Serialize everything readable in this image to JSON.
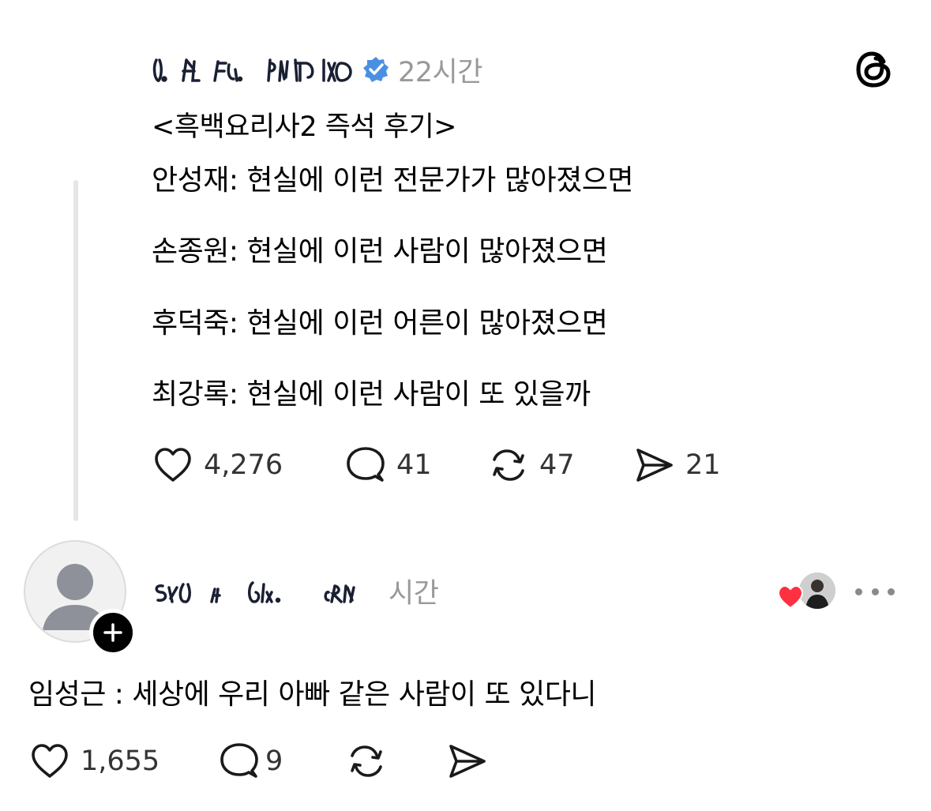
{
  "post": {
    "timestamp": "22시간",
    "title": "<흑백요리사2 즉석 후기>",
    "lines": [
      "안성재: 현실에 이런 전문가가 많아졌으면",
      "손종원: 현실에 이런 사람이 많아졌으면",
      "후덕죽: 현실에 이런 어른이 많아졌으면",
      "최강록: 현실에 이런 사람이 또 있을까"
    ],
    "actions": {
      "likes": "4,276",
      "replies": "41",
      "reposts": "47",
      "shares": "21"
    }
  },
  "comment": {
    "timestamp": "시간",
    "text": "임성근 : 세상에 우리 아빠 같은 사람이 또 있다니",
    "actions": {
      "likes": "1,655",
      "replies": "9"
    }
  },
  "icons": {
    "app_logo": "threads-logo-icon",
    "verified": "verified-badge-icon",
    "like": "heart-icon",
    "reply": "speech-bubble-icon",
    "repost": "repost-icon",
    "share": "send-icon",
    "follow": "plus-icon",
    "more": "more-horizontal-icon"
  },
  "colors": {
    "verified_blue": "#4a90e2",
    "liked_red": "#ff3040",
    "muted_gray": "#999999"
  }
}
